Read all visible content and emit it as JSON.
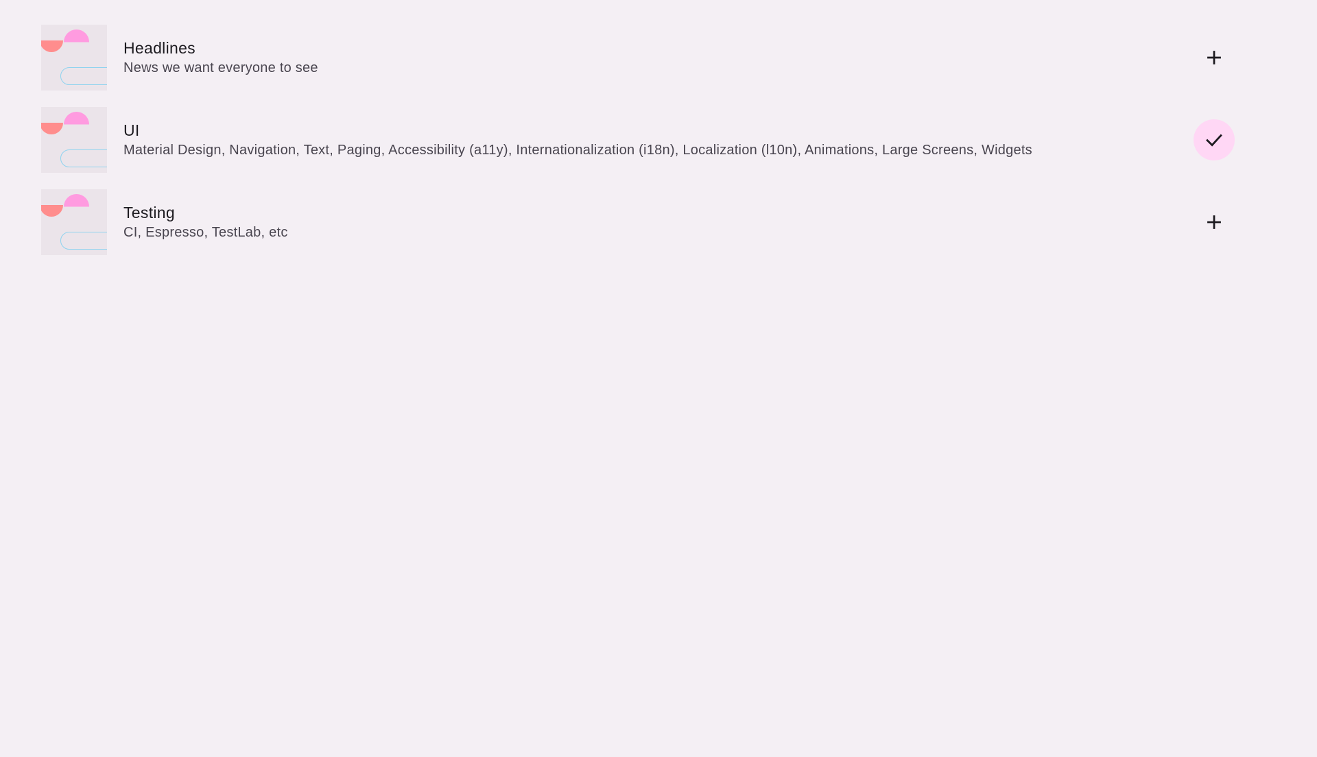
{
  "topics": [
    {
      "name": "Headlines",
      "description": "News we want everyone to see",
      "followed": false,
      "icon": "plus-icon"
    },
    {
      "name": "UI",
      "description": "Material Design, Navigation, Text, Paging, Accessibility (a11y), Internationalization (i18n), Localization (l10n), Animations, Large Screens, Widgets",
      "followed": true,
      "icon": "check-icon"
    },
    {
      "name": "Testing",
      "description": "CI, Espresso, TestLab, etc",
      "followed": false,
      "icon": "plus-icon"
    }
  ],
  "colors": {
    "background": "#f4eff4",
    "selected_button": "#ffd7f5",
    "title_text": "#1d1b20",
    "description_text": "#49454f"
  }
}
